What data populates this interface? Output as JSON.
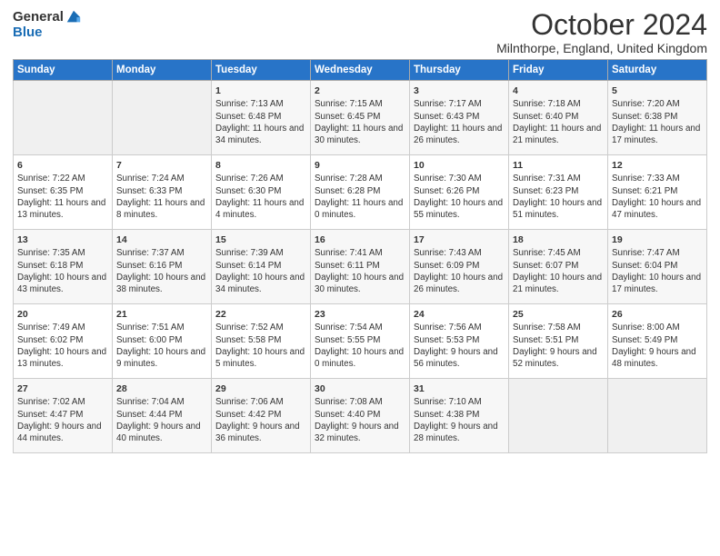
{
  "header": {
    "logo_general": "General",
    "logo_blue": "Blue",
    "title": "October 2024",
    "subtitle": "Milnthorpe, England, United Kingdom"
  },
  "days_of_week": [
    "Sunday",
    "Monday",
    "Tuesday",
    "Wednesday",
    "Thursday",
    "Friday",
    "Saturday"
  ],
  "weeks": [
    [
      {
        "day": "",
        "content": ""
      },
      {
        "day": "",
        "content": ""
      },
      {
        "day": "1",
        "content": "Sunrise: 7:13 AM\nSunset: 6:48 PM\nDaylight: 11 hours and 34 minutes."
      },
      {
        "day": "2",
        "content": "Sunrise: 7:15 AM\nSunset: 6:45 PM\nDaylight: 11 hours and 30 minutes."
      },
      {
        "day": "3",
        "content": "Sunrise: 7:17 AM\nSunset: 6:43 PM\nDaylight: 11 hours and 26 minutes."
      },
      {
        "day": "4",
        "content": "Sunrise: 7:18 AM\nSunset: 6:40 PM\nDaylight: 11 hours and 21 minutes."
      },
      {
        "day": "5",
        "content": "Sunrise: 7:20 AM\nSunset: 6:38 PM\nDaylight: 11 hours and 17 minutes."
      }
    ],
    [
      {
        "day": "6",
        "content": "Sunrise: 7:22 AM\nSunset: 6:35 PM\nDaylight: 11 hours and 13 minutes."
      },
      {
        "day": "7",
        "content": "Sunrise: 7:24 AM\nSunset: 6:33 PM\nDaylight: 11 hours and 8 minutes."
      },
      {
        "day": "8",
        "content": "Sunrise: 7:26 AM\nSunset: 6:30 PM\nDaylight: 11 hours and 4 minutes."
      },
      {
        "day": "9",
        "content": "Sunrise: 7:28 AM\nSunset: 6:28 PM\nDaylight: 11 hours and 0 minutes."
      },
      {
        "day": "10",
        "content": "Sunrise: 7:30 AM\nSunset: 6:26 PM\nDaylight: 10 hours and 55 minutes."
      },
      {
        "day": "11",
        "content": "Sunrise: 7:31 AM\nSunset: 6:23 PM\nDaylight: 10 hours and 51 minutes."
      },
      {
        "day": "12",
        "content": "Sunrise: 7:33 AM\nSunset: 6:21 PM\nDaylight: 10 hours and 47 minutes."
      }
    ],
    [
      {
        "day": "13",
        "content": "Sunrise: 7:35 AM\nSunset: 6:18 PM\nDaylight: 10 hours and 43 minutes."
      },
      {
        "day": "14",
        "content": "Sunrise: 7:37 AM\nSunset: 6:16 PM\nDaylight: 10 hours and 38 minutes."
      },
      {
        "day": "15",
        "content": "Sunrise: 7:39 AM\nSunset: 6:14 PM\nDaylight: 10 hours and 34 minutes."
      },
      {
        "day": "16",
        "content": "Sunrise: 7:41 AM\nSunset: 6:11 PM\nDaylight: 10 hours and 30 minutes."
      },
      {
        "day": "17",
        "content": "Sunrise: 7:43 AM\nSunset: 6:09 PM\nDaylight: 10 hours and 26 minutes."
      },
      {
        "day": "18",
        "content": "Sunrise: 7:45 AM\nSunset: 6:07 PM\nDaylight: 10 hours and 21 minutes."
      },
      {
        "day": "19",
        "content": "Sunrise: 7:47 AM\nSunset: 6:04 PM\nDaylight: 10 hours and 17 minutes."
      }
    ],
    [
      {
        "day": "20",
        "content": "Sunrise: 7:49 AM\nSunset: 6:02 PM\nDaylight: 10 hours and 13 minutes."
      },
      {
        "day": "21",
        "content": "Sunrise: 7:51 AM\nSunset: 6:00 PM\nDaylight: 10 hours and 9 minutes."
      },
      {
        "day": "22",
        "content": "Sunrise: 7:52 AM\nSunset: 5:58 PM\nDaylight: 10 hours and 5 minutes."
      },
      {
        "day": "23",
        "content": "Sunrise: 7:54 AM\nSunset: 5:55 PM\nDaylight: 10 hours and 0 minutes."
      },
      {
        "day": "24",
        "content": "Sunrise: 7:56 AM\nSunset: 5:53 PM\nDaylight: 9 hours and 56 minutes."
      },
      {
        "day": "25",
        "content": "Sunrise: 7:58 AM\nSunset: 5:51 PM\nDaylight: 9 hours and 52 minutes."
      },
      {
        "day": "26",
        "content": "Sunrise: 8:00 AM\nSunset: 5:49 PM\nDaylight: 9 hours and 48 minutes."
      }
    ],
    [
      {
        "day": "27",
        "content": "Sunrise: 7:02 AM\nSunset: 4:47 PM\nDaylight: 9 hours and 44 minutes."
      },
      {
        "day": "28",
        "content": "Sunrise: 7:04 AM\nSunset: 4:44 PM\nDaylight: 9 hours and 40 minutes."
      },
      {
        "day": "29",
        "content": "Sunrise: 7:06 AM\nSunset: 4:42 PM\nDaylight: 9 hours and 36 minutes."
      },
      {
        "day": "30",
        "content": "Sunrise: 7:08 AM\nSunset: 4:40 PM\nDaylight: 9 hours and 32 minutes."
      },
      {
        "day": "31",
        "content": "Sunrise: 7:10 AM\nSunset: 4:38 PM\nDaylight: 9 hours and 28 minutes."
      },
      {
        "day": "",
        "content": ""
      },
      {
        "day": "",
        "content": ""
      }
    ]
  ]
}
